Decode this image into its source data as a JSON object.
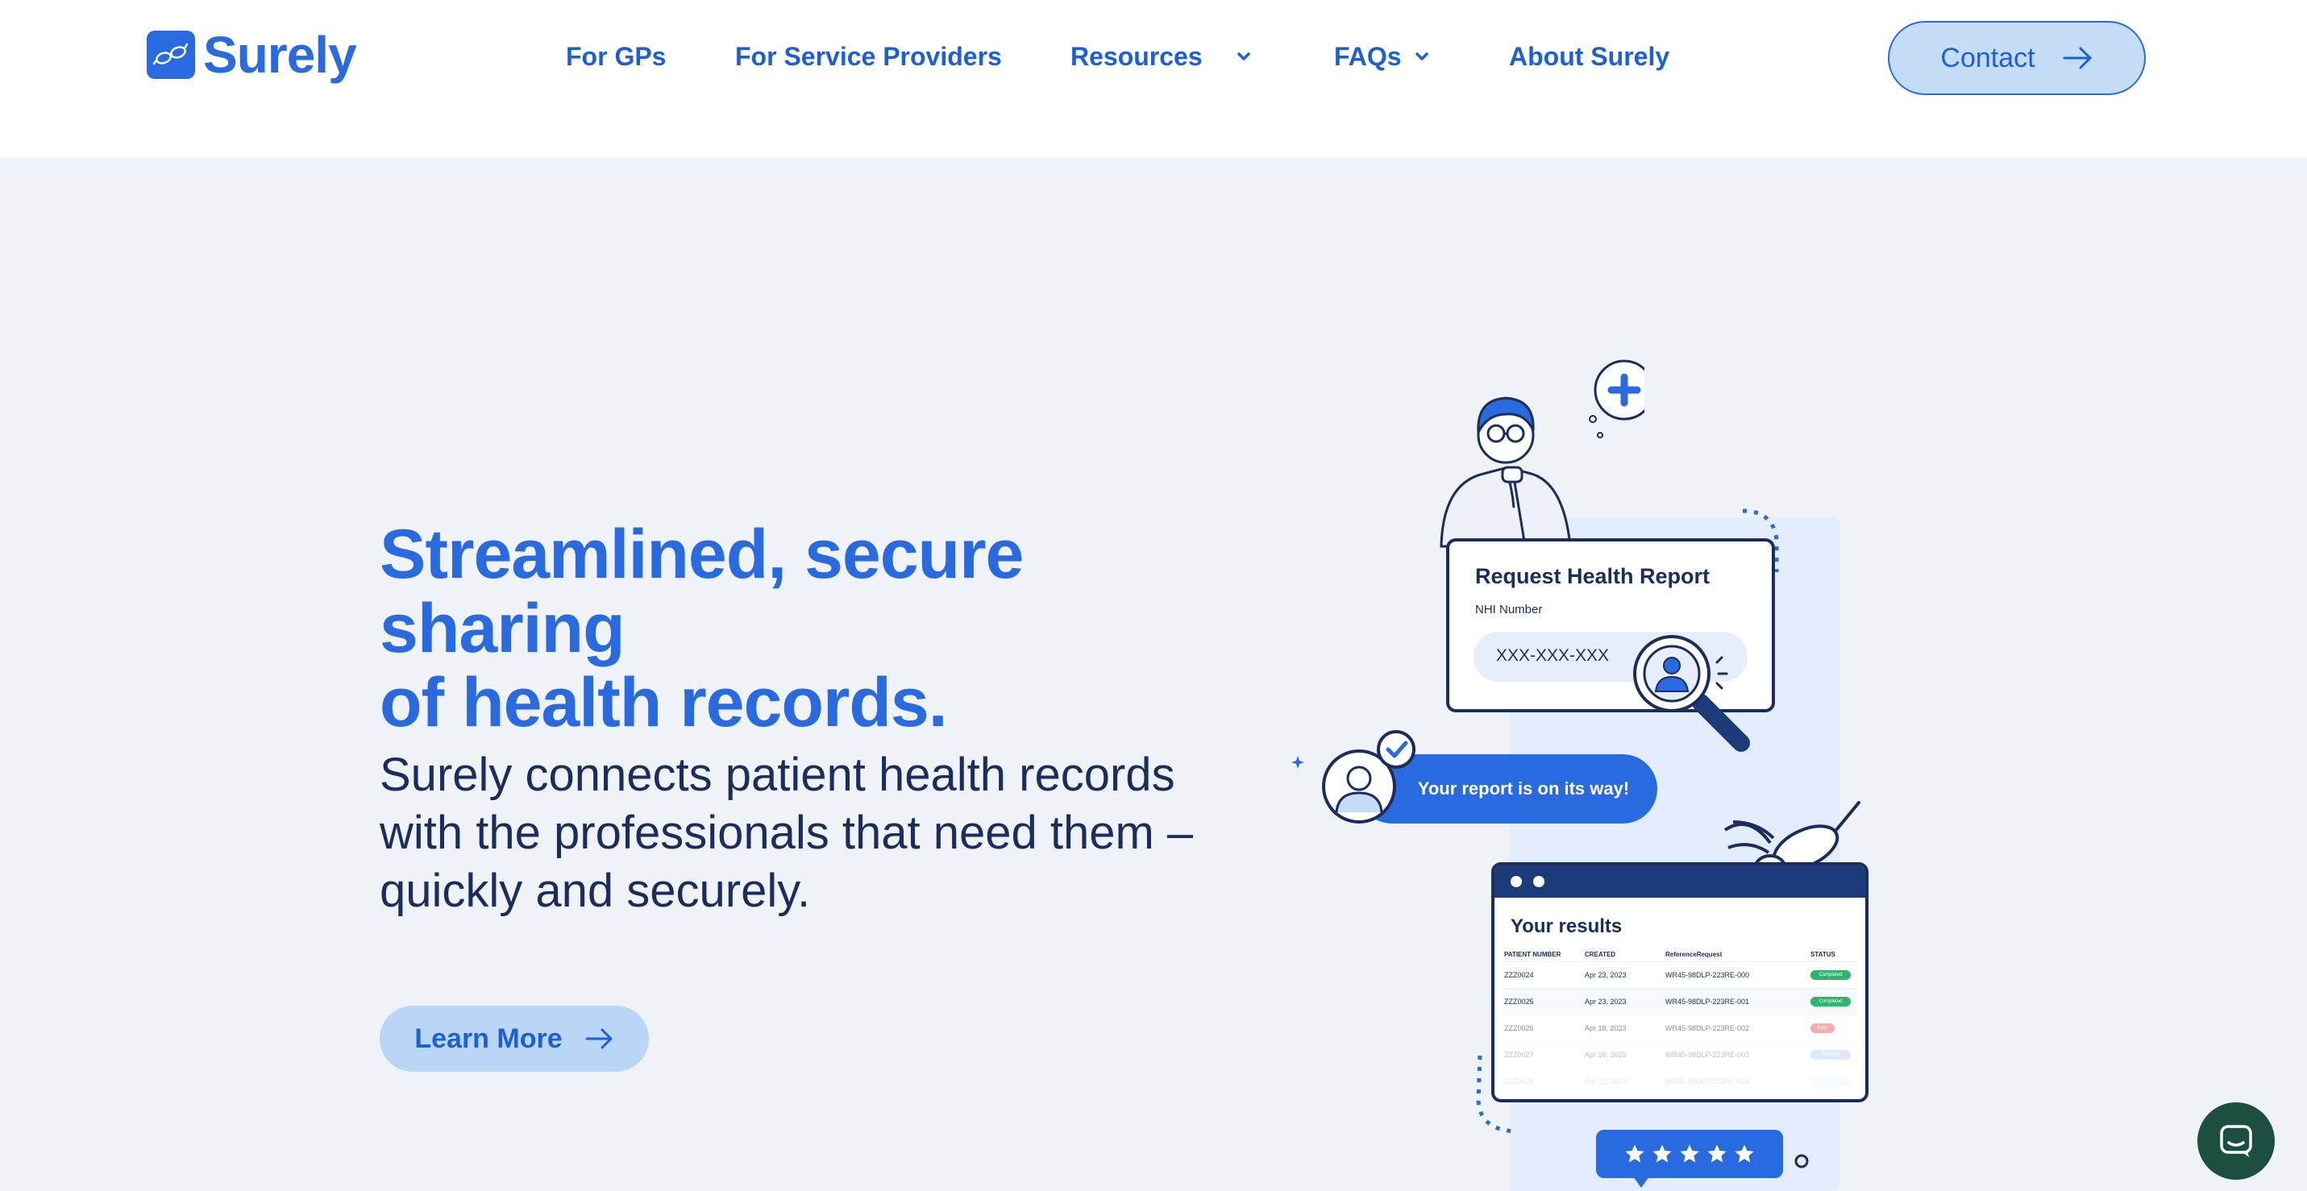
{
  "brand": {
    "name": "Surely",
    "logo_icon": "glasses-logo-icon",
    "accent": "#2a6ae1",
    "navy": "#1b2d5e",
    "background": "#eff3f8"
  },
  "nav": {
    "items": [
      {
        "label": "For GPs",
        "has_dropdown": false
      },
      {
        "label": "For Service Providers",
        "has_dropdown": false
      },
      {
        "label": "Resources",
        "has_dropdown": true
      },
      {
        "label": "FAQs",
        "has_dropdown": true
      },
      {
        "label": "About Surely",
        "has_dropdown": false
      }
    ],
    "contact_label": "Contact"
  },
  "hero": {
    "title_line1": "Streamlined, secure sharing",
    "title_line2": "of health records.",
    "desc_line1": "Surely connects patient health records",
    "desc_line2": "with the professionals that need them –",
    "desc_line3": "quickly and securely.",
    "cta_label": "Learn More"
  },
  "illustration": {
    "request_card": {
      "title": "Request Health Report",
      "field_label": "NHI Number",
      "field_value": "XXX-XXX-XXX"
    },
    "notification": "Your report is on its way!",
    "results": {
      "title": "Your results",
      "columns": [
        "PATIENT NUMBER",
        "CREATED",
        "ReferenceRequest",
        "STATUS"
      ],
      "rows": [
        {
          "patient": "ZZZ0024",
          "created": "Apr 23, 2023",
          "reference": "WR45-98DLP-223RE-000",
          "status": "Completed",
          "status_color": "#2fb56a"
        },
        {
          "patient": "ZZZ0025",
          "created": "Apr 23, 2023",
          "reference": "WR45-98DLP-223RE-001",
          "status": "Completed",
          "status_color": "#2fb56a"
        },
        {
          "patient": "ZZZ0026",
          "created": "Apr 18, 2023",
          "reference": "WR45-98DLP-223RE-002",
          "status": "Error",
          "status_color": "#f06b6b"
        },
        {
          "patient": "ZZZ0027",
          "created": "Apr 16, 2023",
          "reference": "WR45-98DLP-223RE-003",
          "status": "Pending",
          "status_color": "#8fb6f2"
        },
        {
          "patient": "ZZZ0028",
          "created": "Apr 12, 2023",
          "reference": "WR45-98DLP-223RE-004",
          "status": "",
          "status_color": "#c5dcf7"
        }
      ]
    },
    "rating_stars": 5
  },
  "chat_widget": {
    "icon": "chat-bubble-icon",
    "color": "#1c4f40"
  }
}
